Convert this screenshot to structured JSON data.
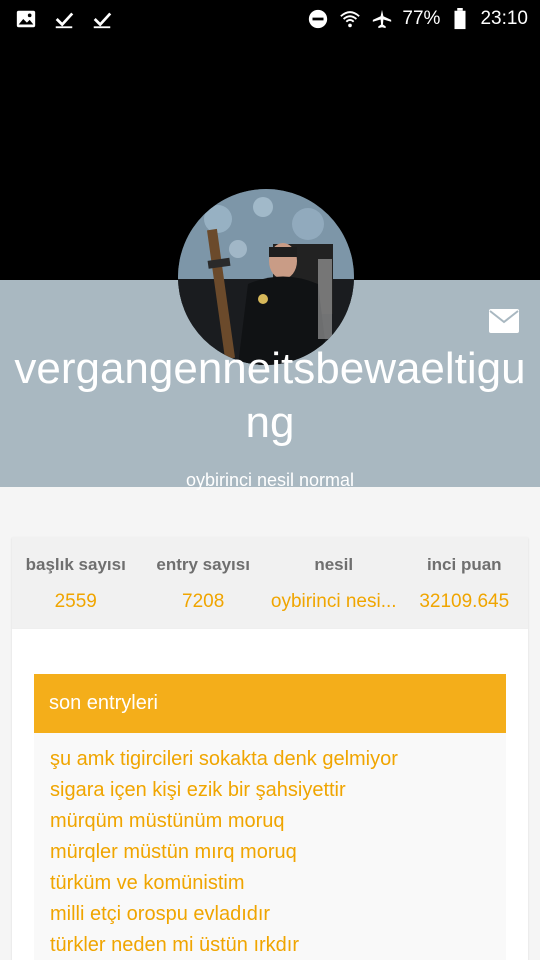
{
  "status_bar": {
    "left_icons": [
      "image-icon",
      "check-icon",
      "check-icon"
    ],
    "battery_percent": "77%",
    "time": "23:10"
  },
  "profile": {
    "username": "vergangenneitsbewaeltigung",
    "generation_label": "oybirinci nesil normal"
  },
  "stats": [
    {
      "label": "başlık sayısı",
      "value": "2559"
    },
    {
      "label": "entry sayısı",
      "value": "7208"
    },
    {
      "label": "nesil",
      "value": "oybirinci nesi..."
    },
    {
      "label": "inci puan",
      "value": "32109.645"
    }
  ],
  "recent_entries": {
    "title": "son entryleri",
    "items": [
      "şu amk tigircileri sokakta denk gelmiyor",
      "sigara içen kişi ezik bir şahsiyettir",
      "mürqüm müstünüm moruq",
      "mürqler müstün mırq moruq",
      "türküm ve komünistim",
      "milli etçi orospu evladıdır",
      "türkler neden mi üstün ırkdır"
    ]
  },
  "colors": {
    "accent": "#f4ae1a",
    "link": "#f0a500",
    "header_band": "#a9b8c1"
  }
}
